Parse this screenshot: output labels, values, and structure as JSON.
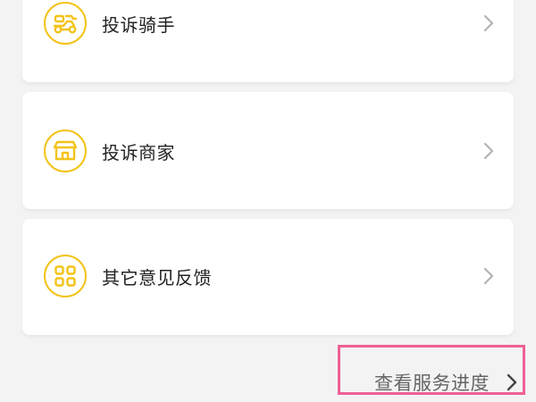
{
  "colors": {
    "accent": "#f3c317",
    "highlight_box": "#ef5f95",
    "card_background": "#ffffff",
    "page_background": "#f3f3f3"
  },
  "menu": {
    "items": [
      {
        "label": "投诉骑手",
        "icon": "scooter-icon"
      },
      {
        "label": "投诉商家",
        "icon": "store-icon"
      },
      {
        "label": "其它意见反馈",
        "icon": "grid-icon"
      }
    ]
  },
  "footer": {
    "progress_link_label": "查看服务进度",
    "progress_link_icon": "chevron-right-icon"
  }
}
